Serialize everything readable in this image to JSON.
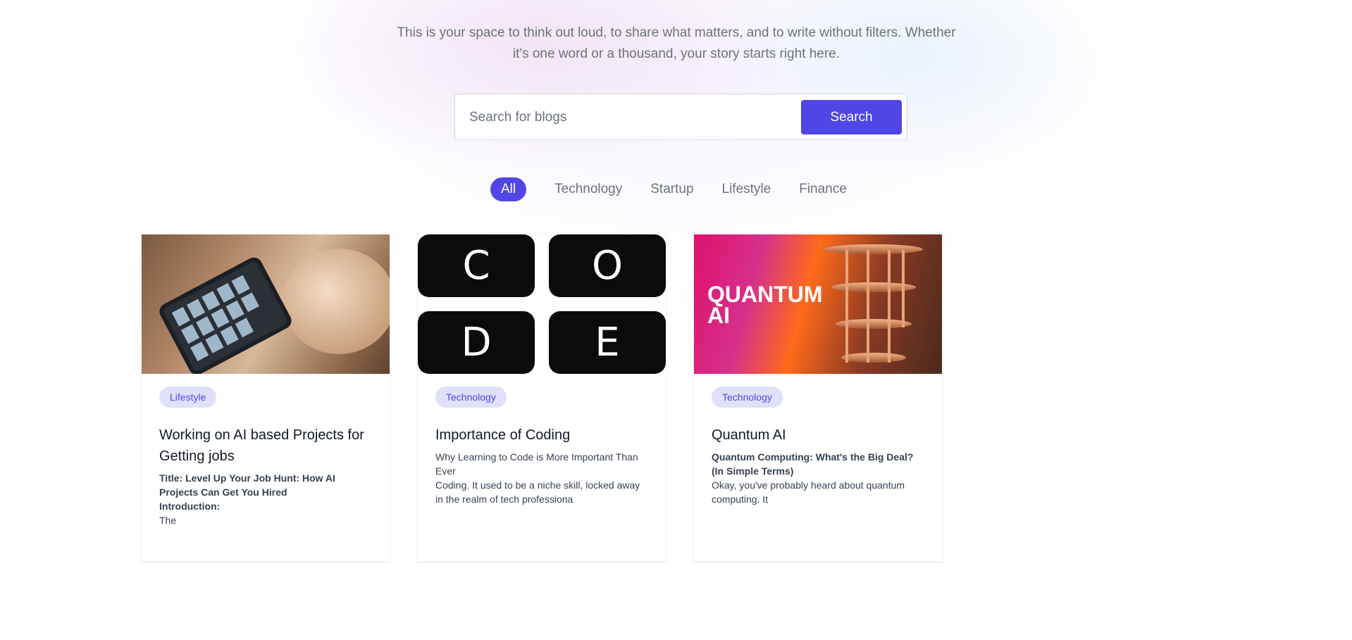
{
  "hero": {
    "intro_line1": "This is your space to think out loud, to share what matters, and to write without filters. Whether",
    "intro_line2": "it's one word or a thousand, your story starts right here."
  },
  "search": {
    "placeholder": "Search for blogs",
    "value": "",
    "button_label": "Search"
  },
  "categories": {
    "active": "All",
    "items": [
      "All",
      "Technology",
      "Startup",
      "Lifestyle",
      "Finance"
    ]
  },
  "colors": {
    "accent": "#4f46e5",
    "badge_bg": "#e0e0fb"
  },
  "posts": [
    {
      "category": "Lifestyle",
      "title": "Working on AI based Projects for Getting jobs",
      "excerpt_bold_1": "Title: Level Up Your Job Hunt: How AI Projects Can Get You Hired",
      "excerpt_bold_2": "Introduction:",
      "excerpt_text": "The",
      "image": "tablet-hand-photo"
    },
    {
      "category": "Technology",
      "title": "Importance of Coding",
      "excerpt_line_1": "Why Learning to Code is More Important Than Ever",
      "excerpt_text": "Coding. It used to be a niche skill, locked away in the realm of tech professiona",
      "image": "code-tiles",
      "image_letters": [
        "C",
        "O",
        "D",
        "E"
      ]
    },
    {
      "category": "Technology",
      "title": "Quantum AI",
      "excerpt_bold_1": "Quantum Computing: What's the Big Deal? (In Simple Terms)",
      "excerpt_text": "Okay, you've probably heard about quantum computing. It",
      "image": "quantum-computer",
      "image_text": "QUANTUM AI"
    }
  ]
}
